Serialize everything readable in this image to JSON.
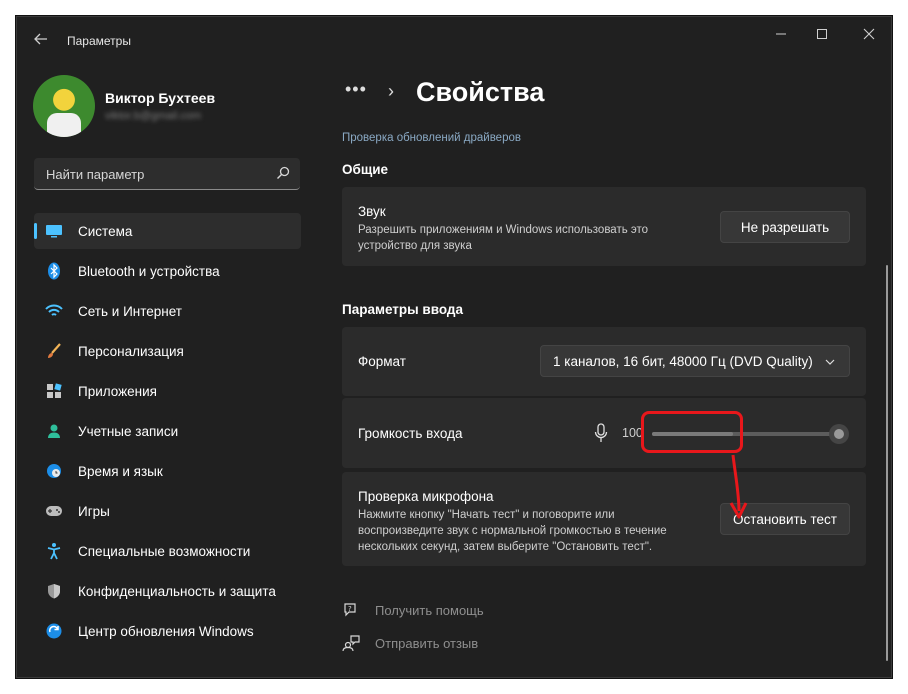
{
  "window": {
    "title": "Параметры",
    "back_icon": "back-arrow-icon",
    "controls": [
      "minimize-icon",
      "maximize-icon",
      "close-icon"
    ]
  },
  "user": {
    "name": "Виктор Бухтеев",
    "email": "viktor.b@gmail.com"
  },
  "search": {
    "placeholder": "Найти параметр",
    "icon": "search-icon"
  },
  "sidebar": {
    "items": [
      {
        "label": "Система",
        "icon": "monitor-icon",
        "active": true
      },
      {
        "label": "Bluetooth и устройства",
        "icon": "bluetooth-icon"
      },
      {
        "label": "Сеть и Интернет",
        "icon": "wifi-icon"
      },
      {
        "label": "Персонализация",
        "icon": "brush-icon"
      },
      {
        "label": "Приложения",
        "icon": "apps-icon"
      },
      {
        "label": "Учетные записи",
        "icon": "person-icon"
      },
      {
        "label": "Время и язык",
        "icon": "globe-clock-icon"
      },
      {
        "label": "Игры",
        "icon": "gamepad-icon"
      },
      {
        "label": "Специальные возможности",
        "icon": "accessibility-icon"
      },
      {
        "label": "Конфиденциальность и защита",
        "icon": "shield-icon"
      },
      {
        "label": "Центр обновления Windows",
        "icon": "update-icon"
      }
    ]
  },
  "header": {
    "breadcrumb_dots": "•••",
    "chevron": "›",
    "title": "Свойства"
  },
  "main": {
    "top_link": "Проверка обновлений драйверов",
    "general": {
      "heading": "Общие",
      "sound": {
        "title": "Звук",
        "description_line1": "Разрешить приложениям и Windows использовать это",
        "description_line2": "устройство для звука",
        "button": "Не разрешать"
      }
    },
    "input": {
      "heading": "Параметры ввода",
      "format": {
        "label": "Формат",
        "value": "1 каналов, 16 бит, 48000 Гц (DVD Quality)"
      },
      "volume": {
        "label": "Громкость входа",
        "value": "100",
        "level_fraction": 0.43,
        "slider_fraction": 1.0
      },
      "mic_test": {
        "title": "Проверка микрофона",
        "description_line1": "Нажмите кнопку \"Начать тест\" и поговорите или",
        "description_line2": "воспроизведите звук с нормальной громкостью в течение",
        "description_line3": "нескольких секунд, затем выберите \"Остановить тест\".",
        "button": "Остановить тест"
      }
    }
  },
  "footer": {
    "help": "Получить помощь",
    "feedback": "Отправить отзыв"
  },
  "colors": {
    "background": "#202020",
    "card": "#2b2b2b",
    "accent": "#4cc2ff",
    "annotation": "#e8171b"
  }
}
